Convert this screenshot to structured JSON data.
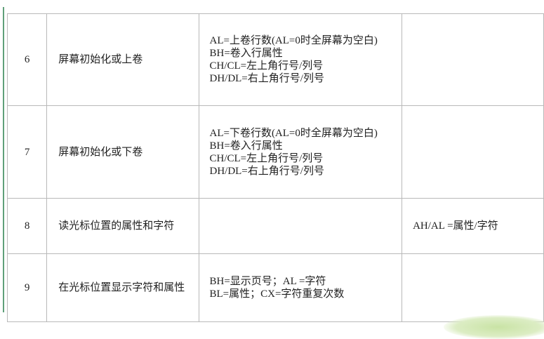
{
  "rows": [
    {
      "number": "6",
      "function": "屏幕初始化或上卷",
      "input": [
        "AL=上卷行数(AL=0时全屏幕为空白)",
        "BH=卷入行属性",
        "CH/CL=左上角行号/列号",
        "DH/DL=右上角行号/列号"
      ],
      "output": ""
    },
    {
      "number": "7",
      "function": "屏幕初始化或下卷",
      "input": [
        "AL=下卷行数(AL=0时全屏幕为空白)",
        "BH=卷入行属性",
        "CH/CL=左上角行号/列号",
        "DH/DL=右上角行号/列号"
      ],
      "output": ""
    },
    {
      "number": "8",
      "function": "读光标位置的属性和字符",
      "input": [],
      "output": "AH/AL =属性/字符"
    },
    {
      "number": "9",
      "function": "在光标位置显示字符和属性",
      "input": [
        "BH=显示页号；AL =字符",
        "BL=属性；CX=字符重复次数"
      ],
      "output": ""
    }
  ],
  "colors": {
    "border": "#b9b9b9",
    "accent": "#5fa07a"
  }
}
